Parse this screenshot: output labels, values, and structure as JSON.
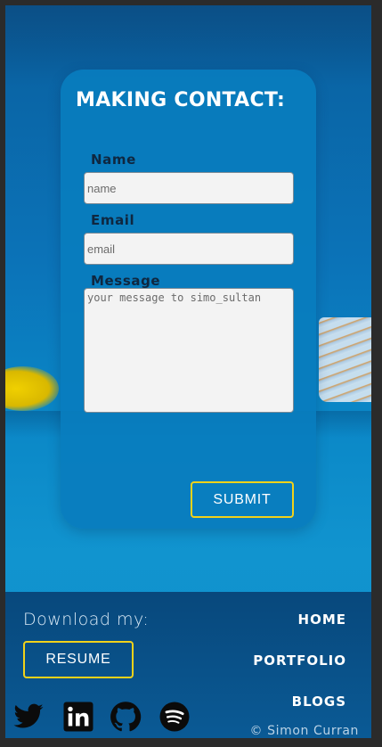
{
  "contact_form": {
    "title": "MAKING CONTACT:",
    "name_label": "Name",
    "name_placeholder": "name",
    "email_label": "Email",
    "email_placeholder": "email",
    "message_label": "Message",
    "message_placeholder": "your message to simo_sultan",
    "submit_label": "SUBMIT"
  },
  "footer": {
    "download_label": "Download my:",
    "resume_label": "RESUME",
    "nav": [
      "HOME",
      "PORTFOLIO",
      "BLOGS"
    ],
    "social_icons": [
      "twitter-icon",
      "linkedin-icon",
      "github-icon",
      "spotify-icon"
    ],
    "copyright": "© Simon Curran"
  },
  "colors": {
    "accent_yellow": "#f2d21a",
    "card_blue": "#097dbe",
    "footer_blue": "#08487c",
    "label_dark": "#0f2740"
  }
}
